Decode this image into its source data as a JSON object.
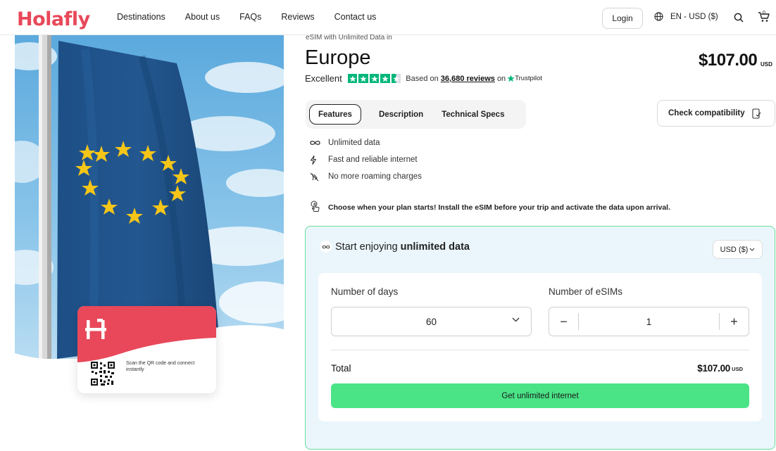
{
  "header": {
    "logo": "Holafly",
    "nav": [
      "Destinations",
      "About us",
      "FAQs",
      "Reviews",
      "Contact us"
    ],
    "login_label": "Login",
    "language": "EN - USD ($)",
    "cart_count": "0"
  },
  "product": {
    "subtitle": "eSIM with Unlimited Data in",
    "country": "Europe",
    "price": "$107.00",
    "price_currency": "USD",
    "rating": {
      "label": "Excellent",
      "stars": 4.5,
      "based_on": "Based on",
      "reviews_count": "36,680 reviews",
      "on": "on",
      "platform": "Trustpilot"
    }
  },
  "tabs": [
    {
      "label": "Features",
      "active": true
    },
    {
      "label": "Description",
      "active": false
    },
    {
      "label": "Technical Specs",
      "active": false
    }
  ],
  "check_compatibility_label": "Check compatibility",
  "features": [
    {
      "icon": "infinity-icon",
      "text": "Unlimited data"
    },
    {
      "icon": "lightning-icon",
      "text": "Fast and reliable internet"
    },
    {
      "icon": "no-roaming-icon",
      "text": "No more roaming charges"
    }
  ],
  "notice": "Choose when your plan starts! Install the eSIM before your trip and activate the data upon arrival.",
  "qr_card": {
    "text": "Scan the QR code and connect instantly"
  },
  "buybox": {
    "heading_prefix": "Start enjoying",
    "heading_bold": "unlimited data",
    "currency_select": "USD ($)",
    "days_label": "Number of days",
    "days_value": "60",
    "esims_label": "Number of eSIMs",
    "esims_value": "1",
    "minus": "−",
    "plus": "+",
    "total_label": "Total",
    "total_value": "$107.00",
    "total_currency": "USD",
    "cta_label": "Get unlimited internet"
  },
  "colors": {
    "brand": "#e8485a",
    "accent_green": "#4ae487",
    "trustpilot_green": "#00b67a",
    "box_bg": "#eaf6fb",
    "box_border": "#69e09a"
  }
}
